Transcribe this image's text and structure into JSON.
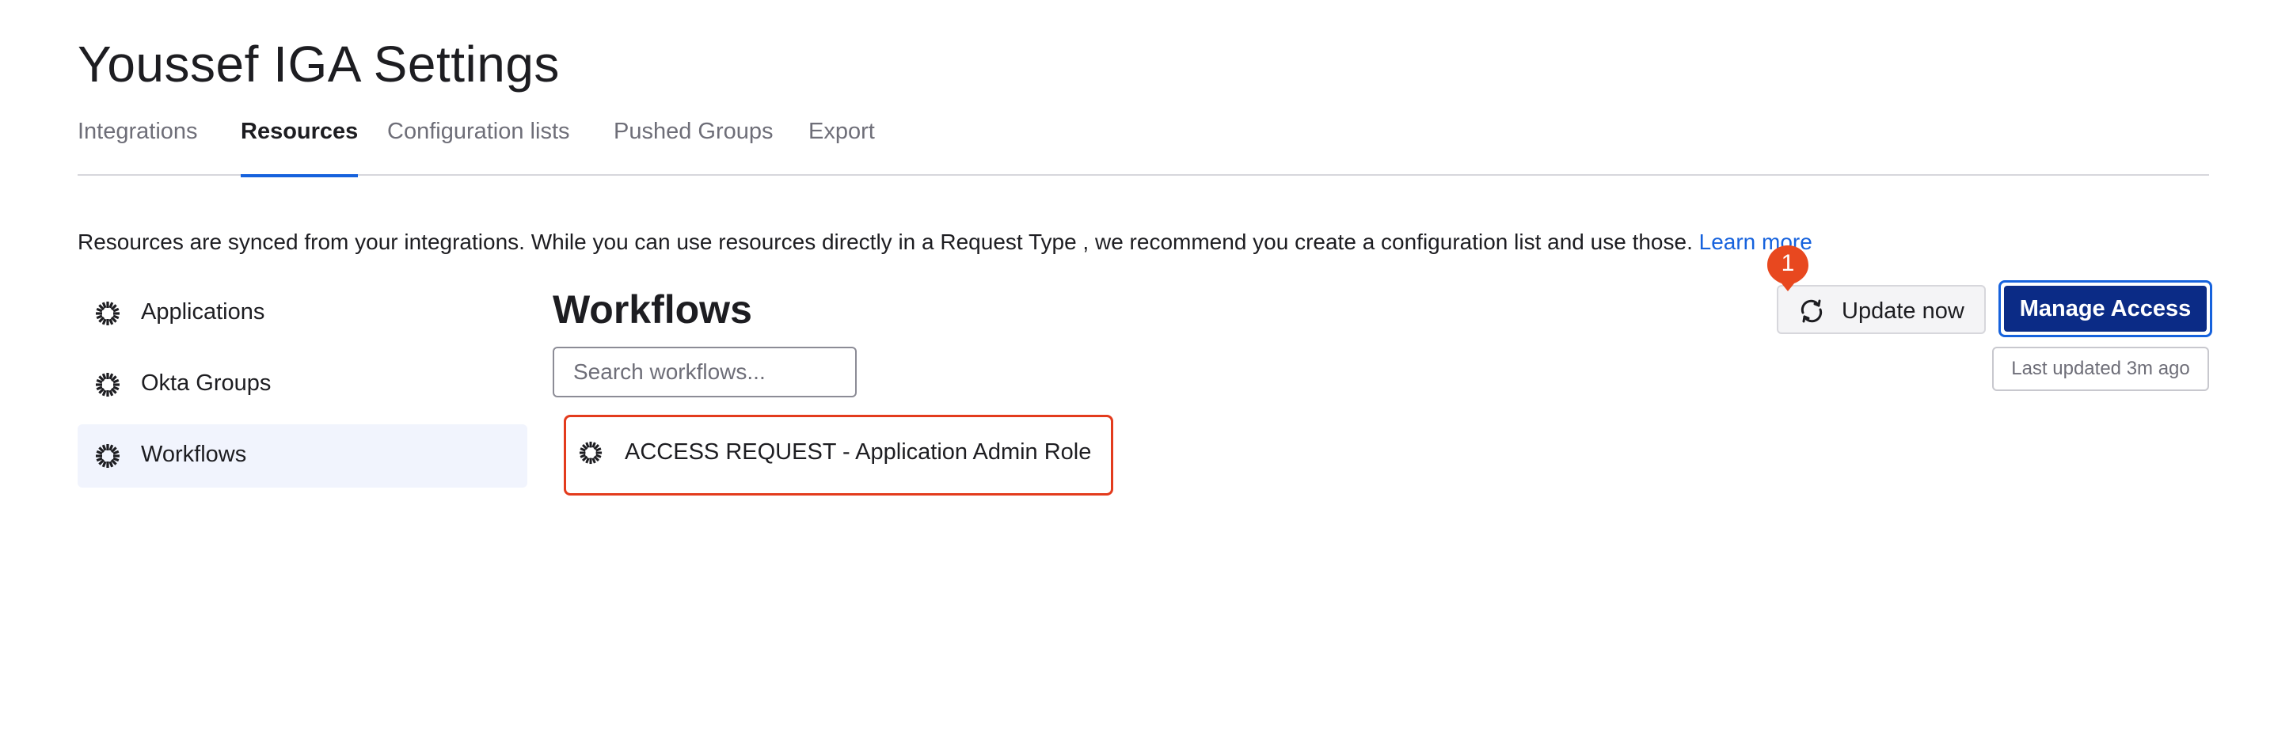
{
  "page": {
    "title": "Youssef IGA Settings"
  },
  "tabs": [
    {
      "label": "Integrations",
      "active": false
    },
    {
      "label": "Resources",
      "active": true
    },
    {
      "label": "Configuration lists",
      "active": false
    },
    {
      "label": "Pushed Groups",
      "active": false
    },
    {
      "label": "Export",
      "active": false
    }
  ],
  "intro": {
    "text": "Resources are synced from your integrations. While you can use resources directly in a Request Type , we recommend you create a configuration list and use those. ",
    "link_label": "Learn more"
  },
  "sidebar": {
    "items": [
      {
        "label": "Applications",
        "icon": "okta-burst-icon",
        "selected": false
      },
      {
        "label": "Okta Groups",
        "icon": "okta-burst-icon",
        "selected": false
      },
      {
        "label": "Workflows",
        "icon": "okta-burst-icon",
        "selected": true
      }
    ]
  },
  "main": {
    "heading": "Workflows",
    "search": {
      "placeholder": "Search workflows...",
      "value": ""
    },
    "results": [
      {
        "label": "ACCESS REQUEST - Application Admin Role",
        "icon": "okta-burst-icon",
        "highlighted": true
      }
    ]
  },
  "actions": {
    "update_label": "Update now",
    "update_icon": "sync-icon",
    "manage_label": "Manage Access",
    "last_updated": "Last updated 3m ago"
  },
  "annotation": {
    "marker_number": "1",
    "marker_color": "#e8481f",
    "highlight_color": "#e33b1d"
  },
  "colors": {
    "accent": "#1662dd",
    "primary_button": "#0b2b86",
    "selected_bg": "#f1f4fd"
  }
}
